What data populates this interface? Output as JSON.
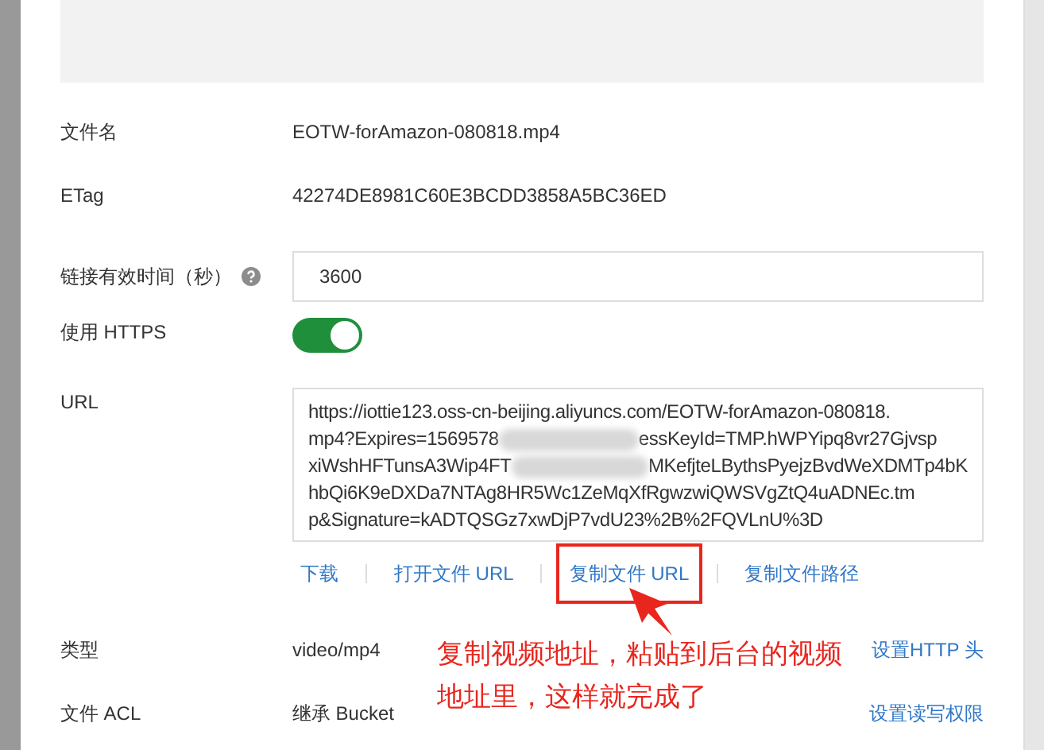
{
  "fields": [
    {
      "kind": "text",
      "label": "文件名",
      "value": "EOTW-forAmazon-080818.mp4"
    },
    {
      "kind": "text",
      "label": "ETag",
      "value": "42274DE8981C60E3BCDD3858A5BC36ED"
    },
    {
      "kind": "input",
      "label": "链接有效时间（秒）",
      "help": true,
      "value": "3600"
    },
    {
      "kind": "switch",
      "label": "使用 HTTPS",
      "on": true
    },
    {
      "kind": "url",
      "label": "URL",
      "lines": [
        [
          "https://iottie123.oss-cn-beijing.aliyuncs.com/EOTW-forAmazon-080818."
        ],
        [
          "mp4?Expires=1569578",
          "essKeyId=TMP.hWPYipq8vr27Gjvsp"
        ],
        [
          "xiWshHFTunsA3Wip4FT",
          "MKefjteLBythsPyejzBvdWeXDMTp4bK"
        ],
        [
          "hbQi6K9eDXDa7NTAg8HR5Wc1ZeMqXfRgwzwiQWSVgZtQ4uADNEc.tm"
        ],
        [
          "p&Signature=kADTQSGz7xwDjP7vdU23%2B%2FQVLnU%3D"
        ]
      ],
      "actions": [
        {
          "label": "下载",
          "highlighted": false
        },
        {
          "label": "打开文件 URL",
          "highlighted": false
        },
        {
          "label": "复制文件 URL",
          "highlighted": true
        },
        {
          "label": "复制文件路径",
          "highlighted": false
        }
      ]
    },
    {
      "kind": "text",
      "label": "类型",
      "value": "video/mp4",
      "link": "设置HTTP 头"
    },
    {
      "kind": "text",
      "label": "文件 ACL",
      "value": "继承 Bucket",
      "link": "设置读写权限"
    }
  ],
  "annotation": {
    "text": "复制视频地址，粘贴到后台的视频地址里，这样就完成了"
  }
}
